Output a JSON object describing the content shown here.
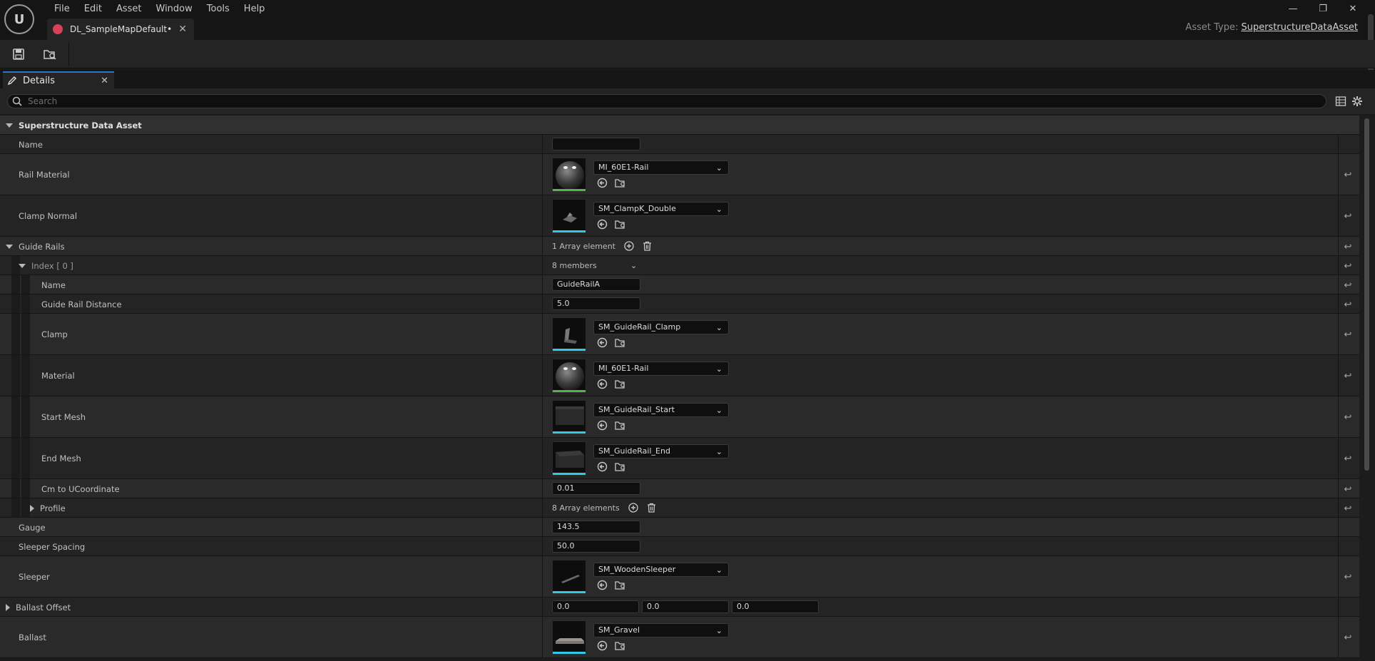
{
  "window": {
    "menu": [
      "File",
      "Edit",
      "Asset",
      "Window",
      "Tools",
      "Help"
    ],
    "tab_title": "DL_SampleMapDefault•",
    "asset_type_label": "Asset Type:",
    "asset_type_value": "SuperstructureDataAsset",
    "controls": {
      "minimize": "—",
      "restore": "❐",
      "close": "✕"
    }
  },
  "toolbar": {
    "buttons": [
      "save-icon",
      "browse-to-asset-icon"
    ]
  },
  "details": {
    "tab_label": "Details",
    "search_placeholder": "Search"
  },
  "colors": {
    "accent_blue": "#2a77c9",
    "material_bar": "#56b34a",
    "mesh_bar": "#32c9e8",
    "tab_icon": "#d9405c"
  },
  "properties": {
    "category": "Superstructure Data Asset",
    "name_label": "Name",
    "name_value": "",
    "rail_material": {
      "label": "Rail Material",
      "value": "MI_60E1-Rail"
    },
    "clamp_normal": {
      "label": "Clamp Normal",
      "value": "SM_ClampK_Double"
    },
    "guide_rails": {
      "label": "Guide Rails",
      "count": "1 Array element"
    },
    "index0": {
      "label": "Index [ 0 ]",
      "members": "8 members"
    },
    "gr_name": {
      "label": "Name",
      "value": "GuideRailA"
    },
    "gr_distance": {
      "label": "Guide Rail Distance",
      "value": "5.0"
    },
    "gr_clamp": {
      "label": "Clamp",
      "value": "SM_GuideRail_Clamp"
    },
    "gr_material": {
      "label": "Material",
      "value": "MI_60E1-Rail"
    },
    "gr_start_mesh": {
      "label": "Start Mesh",
      "value": "SM_GuideRail_Start"
    },
    "gr_end_mesh": {
      "label": "End Mesh",
      "value": "SM_GuideRail_End"
    },
    "gr_cm_to_u": {
      "label": "Cm to UCoordinate",
      "value": "0.01"
    },
    "gr_profile": {
      "label": "Profile",
      "count": "8 Array elements"
    },
    "gauge": {
      "label": "Gauge",
      "value": "143.5"
    },
    "sleeper_spacing": {
      "label": "Sleeper Spacing",
      "value": "50.0"
    },
    "sleeper": {
      "label": "Sleeper",
      "value": "SM_WoodenSleeper"
    },
    "ballast_offset": {
      "label": "Ballast Offset",
      "x": "0.0",
      "y": "0.0",
      "z": "0.0"
    },
    "ballast": {
      "label": "Ballast",
      "value": "SM_Gravel"
    }
  }
}
